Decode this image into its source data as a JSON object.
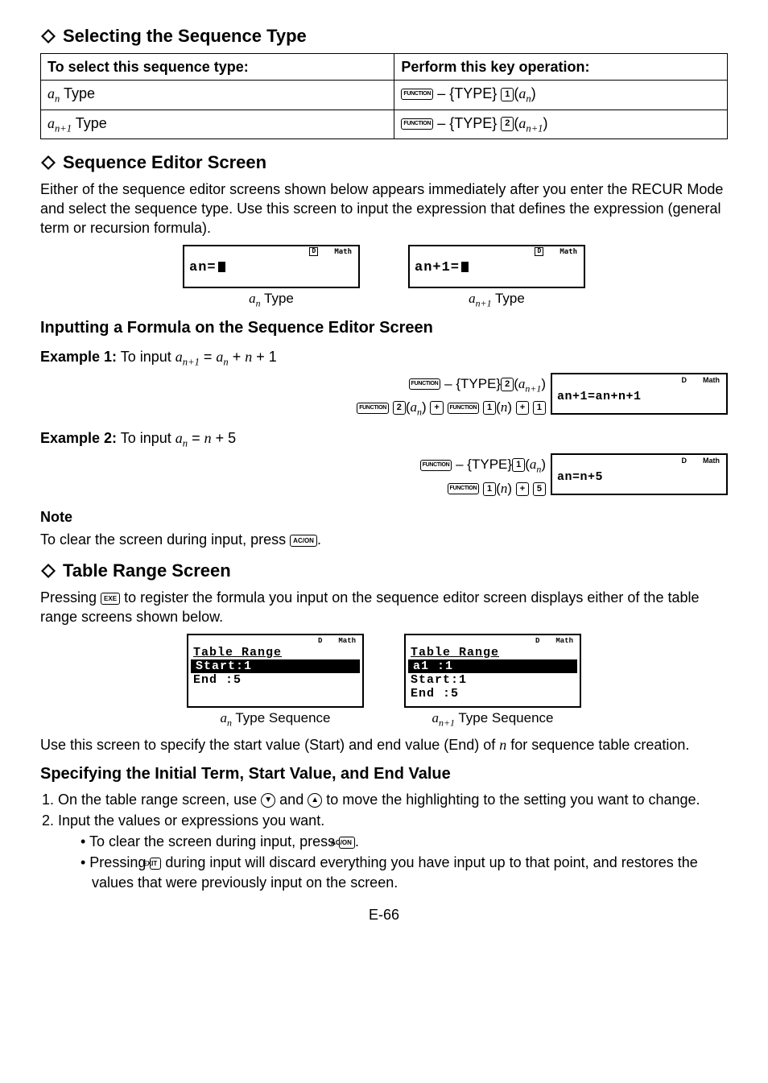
{
  "section1": {
    "title": "Selecting the Sequence Type",
    "table": {
      "head1": "To select this sequence type:",
      "head2": "Perform this key operation:",
      "row1_type": "aₙ Type",
      "row1_op_text": " – {TYPE}",
      "row2_type": "aₙ₊₁ Type",
      "row2_op_text": " – {TYPE}"
    }
  },
  "section2": {
    "title": "Sequence Editor Screen",
    "para": "Either of the sequence editor screens shown below appears immediately after you enter the RECUR Mode and select the sequence type. Use this screen to input the expression that defines the expression (general term or recursion formula).",
    "lcd1_content": "an=",
    "lcd1_caption": "aₙ Type",
    "lcd2_content": "an+1=",
    "lcd2_caption": "aₙ₊₁ Type",
    "ind_d": "D",
    "ind_math": "Math"
  },
  "section3": {
    "title": "Inputting a Formula on the Sequence Editor Screen",
    "ex1_label": "Example 1:",
    "ex1_text": " To input aₙ₊₁ = aₙ + n + 1",
    "ex1_lcd": "an+1=an+n+1",
    "ex2_label": "Example 2:",
    "ex2_text": " To input aₙ = n + 5",
    "ex2_lcd": "an=n+5",
    "note_head": "Note",
    "note_text": "To clear the screen during input, press ",
    "note_text2": "."
  },
  "section4": {
    "title": "Table Range Screen",
    "para1": "Pressing ",
    "para2": " to register the formula you input on the sequence editor screen displays either of the table range screens shown below.",
    "lcd1_line1": "Table Range",
    "lcd1_line2": "Start:1",
    "lcd1_line3": "End  :5",
    "lcd1_caption": "aₙ Type Sequence",
    "lcd2_line1": "Table Range",
    "lcd2_line2": "a1   :1",
    "lcd2_line3": "Start:1",
    "lcd2_line4": "End  :5",
    "lcd2_caption": "aₙ₊₁ Type Sequence",
    "para3": "Use this screen to specify the start value (Start) and end value (End) of n for sequence table creation."
  },
  "section5": {
    "title": "Specifying the Initial Term, Start Value, and End Value",
    "li1a": "On the table range screen, use ",
    "li1b": " and ",
    "li1c": " to move the highlighting to the setting you want to change.",
    "li2": "Input the values or expressions you want.",
    "b1a": "• To clear the screen during input, press ",
    "b1b": ".",
    "b2a": "• Pressing ",
    "b2b": " during input will discard everything you have input up to that point, and restores the values that were previously input on the screen."
  },
  "page": "E-66",
  "keys": {
    "function": "FUNCTION",
    "acon": "AC/ON",
    "exe": "EXE",
    "exit": "EXIT",
    "plus": "+",
    "k1": "1",
    "k2": "2",
    "k5": "5"
  },
  "chart_data": {
    "type": "table",
    "title": "Selecting the Sequence Type",
    "columns": [
      "To select this sequence type:",
      "Perform this key operation:"
    ],
    "rows": [
      [
        "a_n Type",
        "FUNCTION – {TYPE} 1 (a_n)"
      ],
      [
        "a_{n+1} Type",
        "FUNCTION – {TYPE} 2 (a_{n+1})"
      ]
    ]
  }
}
